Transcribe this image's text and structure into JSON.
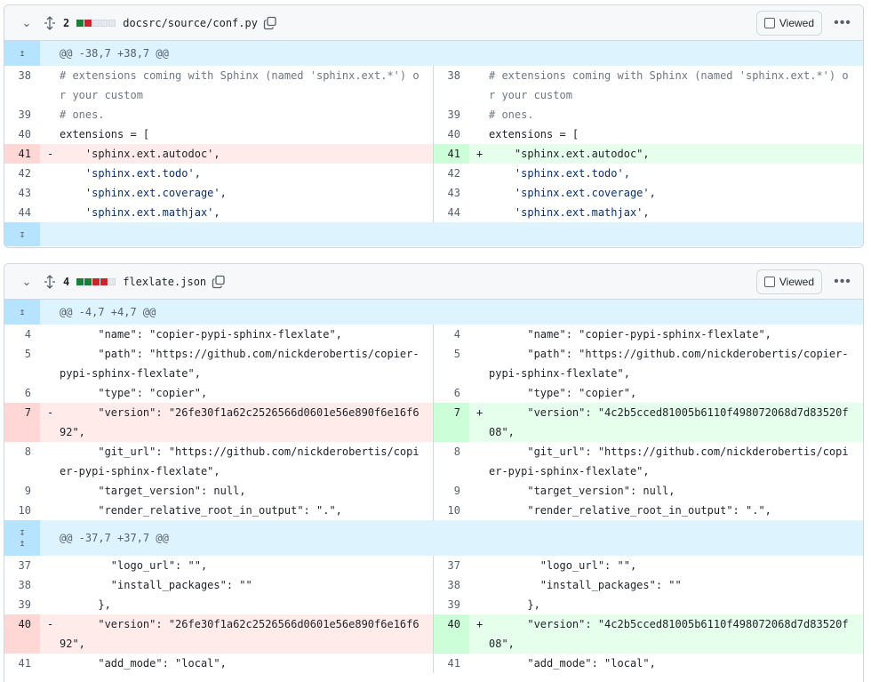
{
  "files": [
    {
      "count": "2",
      "blocks": [
        "#1a7f37",
        "#cf222e",
        "#e6e9ec",
        "#e6e9ec",
        "#e6e9ec"
      ],
      "name": "docsrc/source/conf.py",
      "viewed_label": "Viewed",
      "hunks": [
        {
          "header": "@@ -38,7 +38,7 @@",
          "left": [
            {
              "n": "38",
              "t": "# extensions coming with Sphinx (named 'sphinx.ext.*') or your custom",
              "cls": "c"
            },
            {
              "n": "39",
              "t": "# ones.",
              "cls": "c"
            },
            {
              "n": "40",
              "t": "extensions = ["
            },
            {
              "n": "41",
              "t": "    'sphinx.ext.autodoc',",
              "type": "del"
            },
            {
              "n": "42",
              "t": "    'sphinx.ext.todo',",
              "cls": "s"
            },
            {
              "n": "43",
              "t": "    'sphinx.ext.coverage',",
              "cls": "s"
            },
            {
              "n": "44",
              "t": "    'sphinx.ext.mathjax',",
              "cls": "s"
            }
          ],
          "right": [
            {
              "n": "38",
              "t": "# extensions coming with Sphinx (named 'sphinx.ext.*') or your custom",
              "cls": "c"
            },
            {
              "n": "39",
              "t": "# ones.",
              "cls": "c"
            },
            {
              "n": "40",
              "t": "extensions = ["
            },
            {
              "n": "41",
              "t": "    \"sphinx.ext.autodoc\",",
              "type": "add"
            },
            {
              "n": "42",
              "t": "    'sphinx.ext.todo',",
              "cls": "s"
            },
            {
              "n": "43",
              "t": "    'sphinx.ext.coverage',",
              "cls": "s"
            },
            {
              "n": "44",
              "t": "    'sphinx.ext.mathjax',",
              "cls": "s"
            }
          ]
        }
      ]
    },
    {
      "count": "4",
      "blocks": [
        "#1a7f37",
        "#1a7f37",
        "#cf222e",
        "#cf222e",
        "#e6e9ec"
      ],
      "name": "flexlate.json",
      "viewed_label": "Viewed",
      "hunks": [
        {
          "header": "@@ -4,7 +4,7 @@",
          "left": [
            {
              "n": "4",
              "t": "      \"name\": \"copier-pypi-sphinx-flexlate\","
            },
            {
              "n": "5",
              "t": "      \"path\": \"https://github.com/nickderobertis/copier-pypi-sphinx-flexlate\","
            },
            {
              "n": "6",
              "t": "      \"type\": \"copier\","
            },
            {
              "n": "7",
              "t": "      \"version\": \"26fe30f1a62c2526566d0601e56e890f6e16f692\",",
              "type": "del"
            },
            {
              "n": "8",
              "t": "      \"git_url\": \"https://github.com/nickderobertis/copier-pypi-sphinx-flexlate\","
            },
            {
              "n": "9",
              "t": "      \"target_version\": null,"
            },
            {
              "n": "10",
              "t": "      \"render_relative_root_in_output\": \".\","
            }
          ],
          "right": [
            {
              "n": "4",
              "t": "      \"name\": \"copier-pypi-sphinx-flexlate\","
            },
            {
              "n": "5",
              "t": "      \"path\": \"https://github.com/nickderobertis/copier-pypi-sphinx-flexlate\","
            },
            {
              "n": "6",
              "t": "      \"type\": \"copier\","
            },
            {
              "n": "7",
              "t": "      \"version\": \"4c2b5cced81005b6110f498072068d7d83520f08\",",
              "type": "add"
            },
            {
              "n": "8",
              "t": "      \"git_url\": \"https://github.com/nickderobertis/copier-pypi-sphinx-flexlate\","
            },
            {
              "n": "9",
              "t": "      \"target_version\": null,"
            },
            {
              "n": "10",
              "t": "      \"render_relative_root_in_output\": \".\","
            }
          ]
        },
        {
          "header": "@@ -37,7 +37,7 @@",
          "left": [
            {
              "n": "37",
              "t": "        \"logo_url\": \"\","
            },
            {
              "n": "38",
              "t": "        \"install_packages\": \"\""
            },
            {
              "n": "39",
              "t": "      },"
            },
            {
              "n": "40",
              "t": "      \"version\": \"26fe30f1a62c2526566d0601e56e890f6e16f692\",",
              "type": "del"
            },
            {
              "n": "41",
              "t": "      \"add_mode\": \"local\","
            }
          ],
          "right": [
            {
              "n": "37",
              "t": "        \"logo_url\": \"\","
            },
            {
              "n": "38",
              "t": "        \"install_packages\": \"\""
            },
            {
              "n": "39",
              "t": "      },"
            },
            {
              "n": "40",
              "t": "      \"version\": \"4c2b5cced81005b6110f498072068d7d83520f08\",",
              "type": "add"
            },
            {
              "n": "41",
              "t": "      \"add_mode\": \"local\","
            }
          ]
        }
      ]
    }
  ]
}
